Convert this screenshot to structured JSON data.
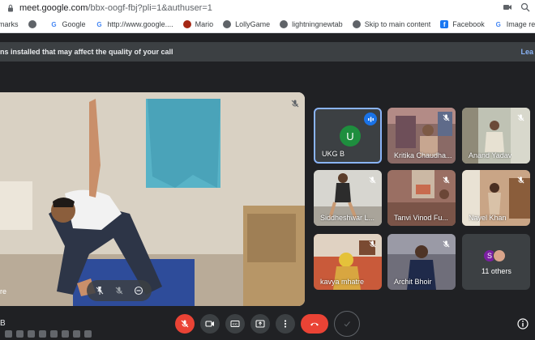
{
  "browser": {
    "url_host": "meet.google.com",
    "url_path": "/bbx-oogf-fbj?pli=1&authuser=1",
    "bookmarks": [
      {
        "label": "marks",
        "icon": "bookmarks-icon"
      },
      {
        "label": "",
        "icon": "globe-icon"
      },
      {
        "label": "Google",
        "icon": "google-icon"
      },
      {
        "label": "http://www.google....",
        "icon": "google-icon"
      },
      {
        "label": "Mario",
        "icon": "mario-icon"
      },
      {
        "label": "LollyGame",
        "icon": "globe-icon"
      },
      {
        "label": "lightningnewtab",
        "icon": "globe-icon"
      },
      {
        "label": "Skip to main content",
        "icon": "globe-icon"
      },
      {
        "label": "Facebook",
        "icon": "facebook-icon"
      },
      {
        "label": "Image result for fan...",
        "icon": "google-icon"
      }
    ]
  },
  "banner": {
    "text": "ns installed that may affect the quality of your call",
    "link": "Lea"
  },
  "main_tile": {
    "name": "re"
  },
  "participants": [
    {
      "name": "UKG B",
      "initial": "U"
    },
    {
      "name": "Kritika Chaudha..."
    },
    {
      "name": "Anand Yadav"
    },
    {
      "name": "Siddheshwar L..."
    },
    {
      "name": "Tanvi Vinod Fu..."
    },
    {
      "name": "Nayel Khan"
    },
    {
      "name": "kavya mhatre"
    },
    {
      "name": "Archit Bhoir"
    }
  ],
  "others": {
    "label": "11 others",
    "initial": "S"
  },
  "meeting": {
    "left_label": "B"
  },
  "colors": {
    "accent": "#8ab4f8",
    "hangup": "#ea4335",
    "avatar_green": "#1e8e3e",
    "speaking_blue": "#1a73e8"
  }
}
